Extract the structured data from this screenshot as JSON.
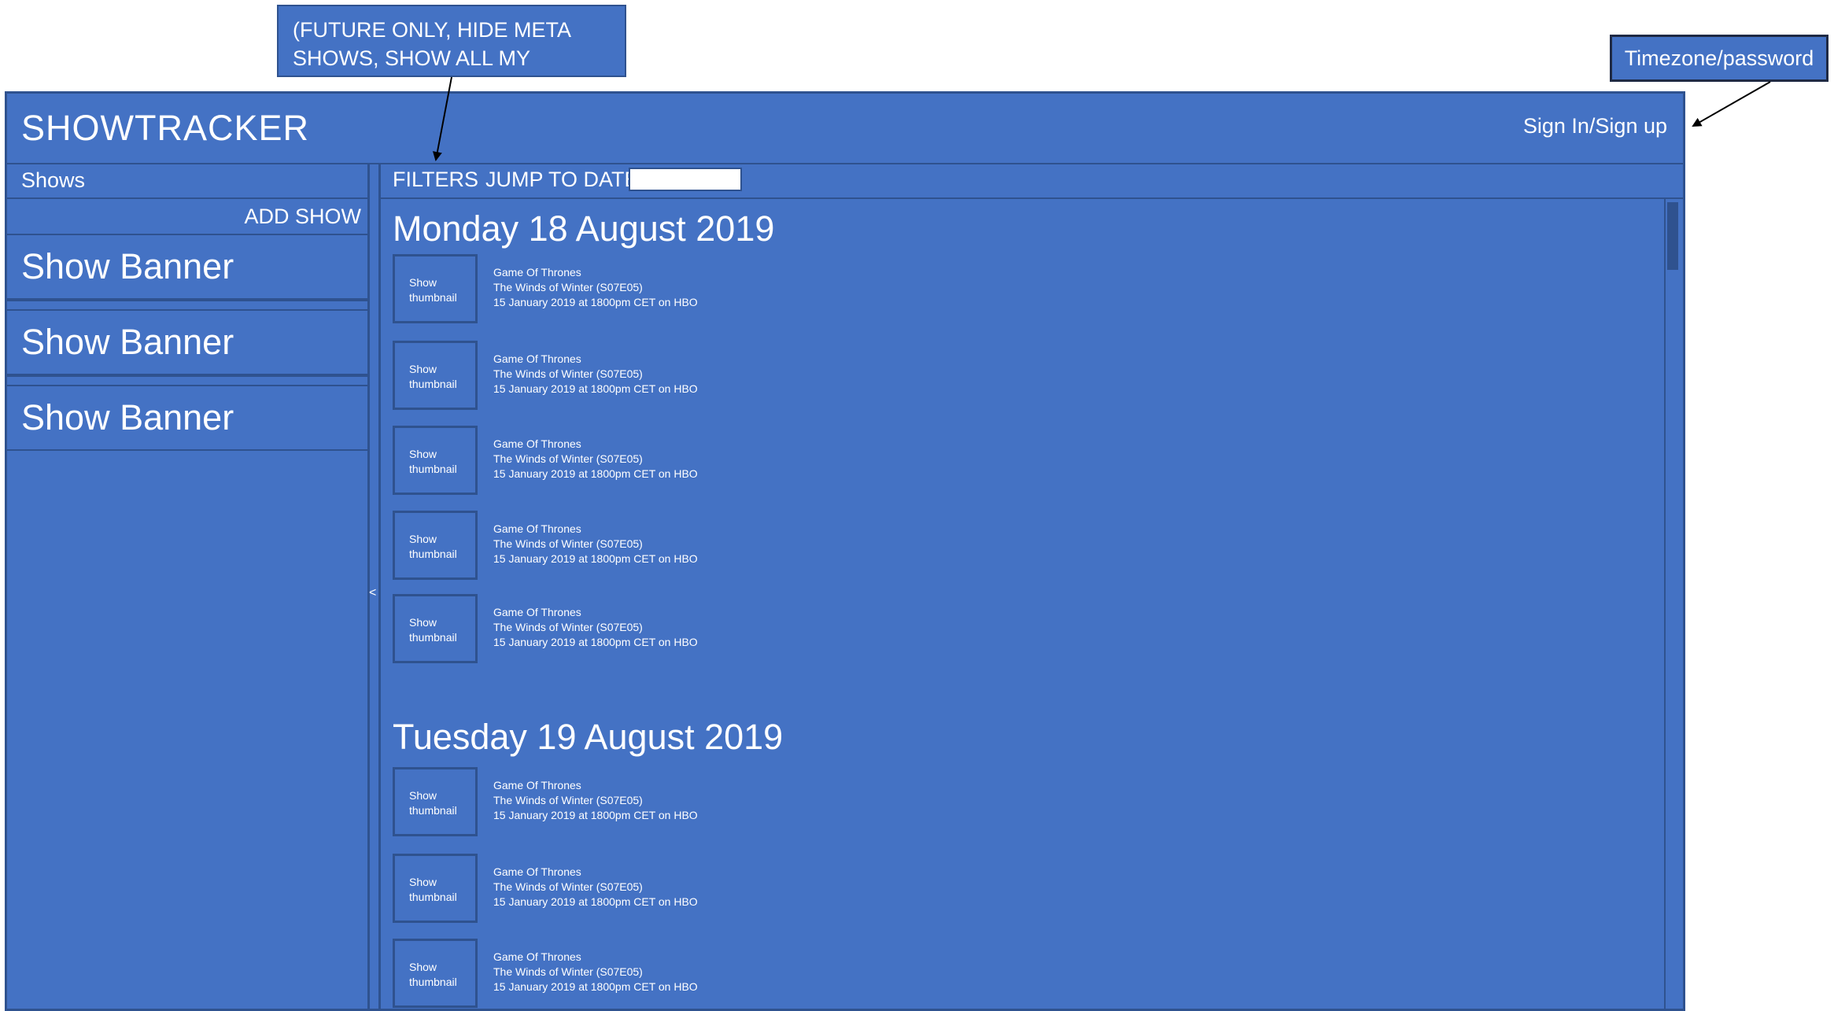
{
  "annotations": {
    "filters_note": "(FUTURE ONLY, HIDE META SHOWS, SHOW ALL MY SHOWS)",
    "timezone_note": "Timezone/password"
  },
  "header": {
    "title": "SHOWTRACKER",
    "signin_label": "Sign In/Sign up"
  },
  "sidebar": {
    "shows_label": "Shows",
    "add_show_label": "ADD SHOW",
    "banners": [
      "Show Banner",
      "Show Banner",
      "Show Banner"
    ],
    "collapse_glyph": "<"
  },
  "toolbar": {
    "filters_label": "FILTERS",
    "jump_label": "JUMP TO DATE:",
    "jump_value": ""
  },
  "days": [
    {
      "heading": "Monday 18 August 2019",
      "episodes": [
        {
          "thumb": "Show\nthumbnail",
          "show": "Game Of Thrones",
          "episode": "The Winds of Winter (S07E05)",
          "airs": "15 January 2019 at 1800pm CET on HBO"
        },
        {
          "thumb": "Show\nthumbnail",
          "show": "Game Of Thrones",
          "episode": "The Winds of Winter (S07E05)",
          "airs": "15 January 2019 at 1800pm CET on HBO"
        },
        {
          "thumb": "Show\nthumbnail",
          "show": "Game Of Thrones",
          "episode": "The Winds of Winter (S07E05)",
          "airs": "15 January 2019 at 1800pm CET on HBO"
        },
        {
          "thumb": "Show\nthumbnail",
          "show": "Game Of Thrones",
          "episode": "The Winds of Winter (S07E05)",
          "airs": "15 January 2019 at 1800pm CET on HBO"
        },
        {
          "thumb": "Show\nthumbnail",
          "show": "Game Of Thrones",
          "episode": "The Winds of Winter (S07E05)",
          "airs": "15 January 2019 at 1800pm CET on HBO"
        }
      ]
    },
    {
      "heading": "Tuesday 19 August 2019",
      "episodes": [
        {
          "thumb": "Show\nthumbnail",
          "show": "Game Of Thrones",
          "episode": "The Winds of Winter (S07E05)",
          "airs": "15 January 2019 at 1800pm CET on HBO"
        },
        {
          "thumb": "Show\nthumbnail",
          "show": "Game Of Thrones",
          "episode": "The Winds of Winter (S07E05)",
          "airs": "15 January 2019 at 1800pm CET on HBO"
        },
        {
          "thumb": "Show\nthumbnail",
          "show": "Game Of Thrones",
          "episode": "The Winds of Winter (S07E05)",
          "airs": "15 January 2019 at 1800pm CET on HBO"
        }
      ]
    }
  ],
  "colors": {
    "panel": "#4472C4",
    "border": "#2F528F",
    "text": "#FFFFFF"
  }
}
